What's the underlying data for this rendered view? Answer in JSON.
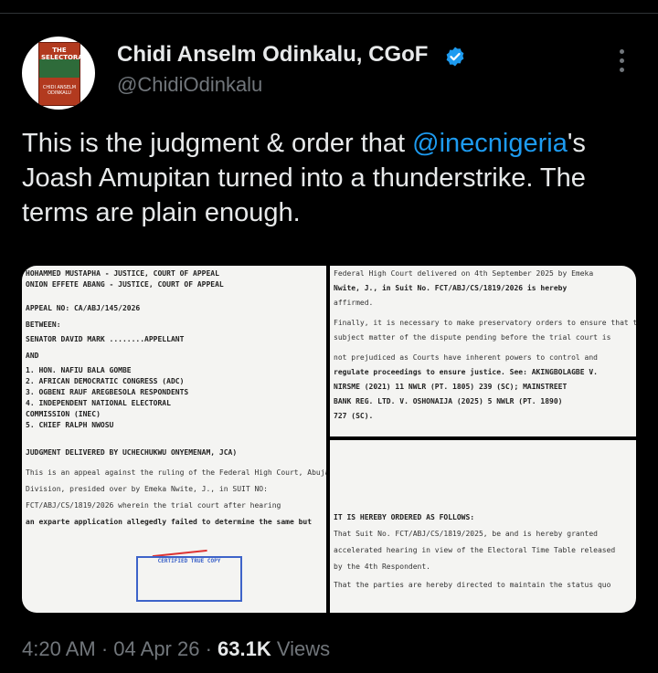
{
  "author": {
    "name": "Chidi Anselm Odinkalu, CGoF",
    "handle": "@ChidiOdinkalu",
    "avatar_book": {
      "title": "THE SELECTORATE",
      "author": "CHIDI ANSELM ODINKALU"
    }
  },
  "tweet": {
    "text_before": "This is the judgment & order that ",
    "mention": "@inecnigeria",
    "text_after": "'s Joash Amupitan turned into a thunderstrike. The terms are plain enough."
  },
  "meta": {
    "time": "4:20 AM",
    "sep1": " · ",
    "date": "04 Apr 26",
    "sep2": " · ",
    "views_count": "63.1K",
    "views_label": " Views"
  },
  "colors": {
    "background": "#000000",
    "text": "#e7e9ea",
    "secondary": "#71767b",
    "link": "#1d9bf0",
    "verified": "#1d9bf0"
  },
  "icons": [
    "verified-badge-icon",
    "more-options-icon"
  ],
  "images": {
    "doc1_lines": [
      "HOHAMMED MUSTAPHA        - JUSTICE, COURT OF APPEAL",
      "ONION EFFETE ABANG       - JUSTICE, COURT OF APPEAL",
      "APPEAL NO: CA/ABJ/145/2026",
      "BETWEEN:",
      "SENATOR DAVID MARK                 ........APPELLANT",
      "AND",
      "1. HON. NAFIU BALA GOMBE",
      "2. AFRICAN DEMOCRATIC CONGRESS (ADC)",
      "3. OGBENI RAUF AREGBESOLA           RESPONDENTS",
      "4. INDEPENDENT NATIONAL ELECTORAL",
      "   COMMISSION (INEC)",
      "5. CHIEF RALPH NWOSU",
      "JUDGMENT DELIVERED BY UCHECHUKWU ONYEMENAM, JCA)",
      "This is an appeal against the ruling of the Federal High Court, Abuja",
      "Division, presided over by Emeka Nwite, J., in SUIT NO:",
      "FCT/ABJ/CS/1819/2026 wherein the trial court after hearing",
      "an exparte application allegedly failed to determine the same but"
    ],
    "doc1_stamp": "CERTIFIED TRUE COPY",
    "doc2_lines": [
      "Federal High Court delivered on 4th September 2025 by Emeka",
      "Nwite, J., in Suit No. FCT/ABJ/CS/1819/2026 is hereby",
      "affirmed.",
      "Finally, it is necessary to make preservatory orders to ensure that the",
      "subject matter of the dispute pending before the trial court is",
      "not prejudiced as Courts have inherent powers to control and",
      "regulate proceedings to ensure justice. See: AKINGBOLAGBE V.",
      "NIRSME (2021) 11 NWLR (PT. 1805) 239 (SC); MAINSTREET",
      "BANK REG. LTD. V. OSHONAIJA (2025) 5 NWLR (PT. 1890)",
      "727 (SC)."
    ],
    "doc3_lines": [
      "IT IS HEREBY ORDERED AS FOLLOWS:",
      "That Suit No. FCT/ABJ/CS/1819/2025, be and is hereby granted",
      "accelerated hearing in view of the Electoral Time Table released",
      "by the 4th Respondent.",
      "That the parties are hereby directed to maintain the status quo"
    ]
  }
}
